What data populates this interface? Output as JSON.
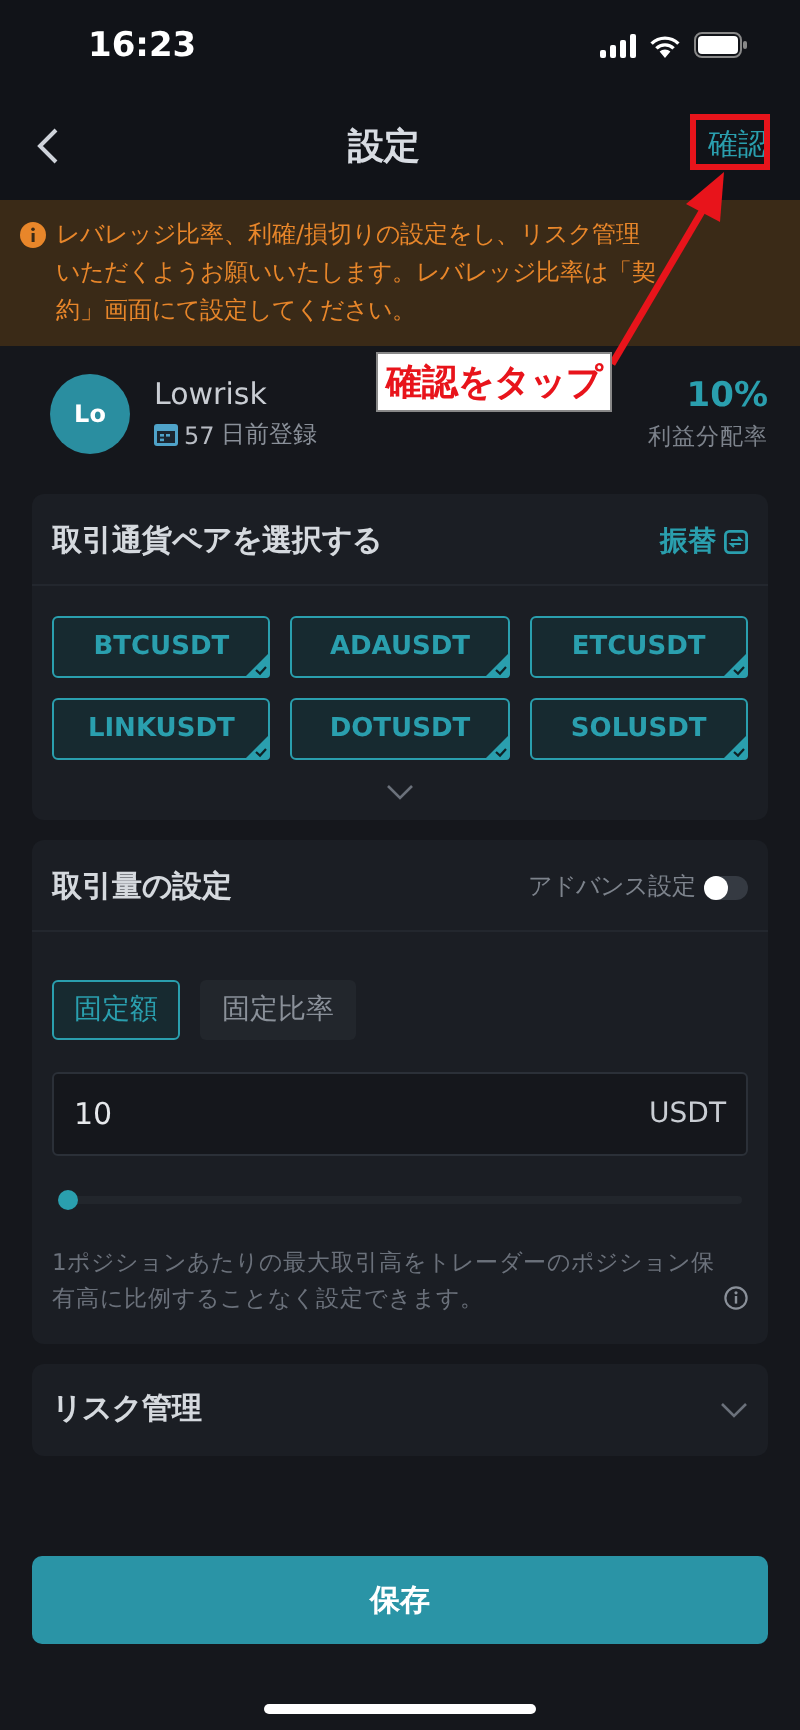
{
  "status_bar": {
    "time": "16:23"
  },
  "header": {
    "title": "設定",
    "confirm": "確認"
  },
  "notice": {
    "text": "レバレッジ比率、利確/損切りの設定をし、リスク管理いただくようお願いいたします。レバレッジ比率は「契約」画面にて設定してください。"
  },
  "annotation": {
    "label": "確認をタップ"
  },
  "trader": {
    "avatar": "Lo",
    "name": "Lowrisk",
    "days": "57",
    "registered": "日前登録",
    "share": "10%",
    "share_label": "利益分配率"
  },
  "pairs": {
    "title": "取引通貨ペアを選択する",
    "switch": "振替",
    "items": [
      {
        "label": "BTCUSDT",
        "selected": true
      },
      {
        "label": "ADAUSDT",
        "selected": true
      },
      {
        "label": "ETCUSDT",
        "selected": true
      },
      {
        "label": "LINKUSDT",
        "selected": true
      },
      {
        "label": "DOTUSDT",
        "selected": true
      },
      {
        "label": "SOLUSDT",
        "selected": true
      }
    ]
  },
  "amount": {
    "title": "取引量の設定",
    "advanced_label": "アドバンス設定",
    "advanced_on": false,
    "modes": [
      {
        "label": "固定額",
        "selected": true
      },
      {
        "label": "固定比率",
        "selected": false
      }
    ],
    "value": "10",
    "unit": "USDT",
    "level": 0,
    "note": "1ポジションあたりの最大取引高をトレーダーのポジション保有高に比例することなく設定できます。"
  },
  "risk": {
    "title": "リスク管理",
    "expanded": false
  },
  "save": "保存"
}
